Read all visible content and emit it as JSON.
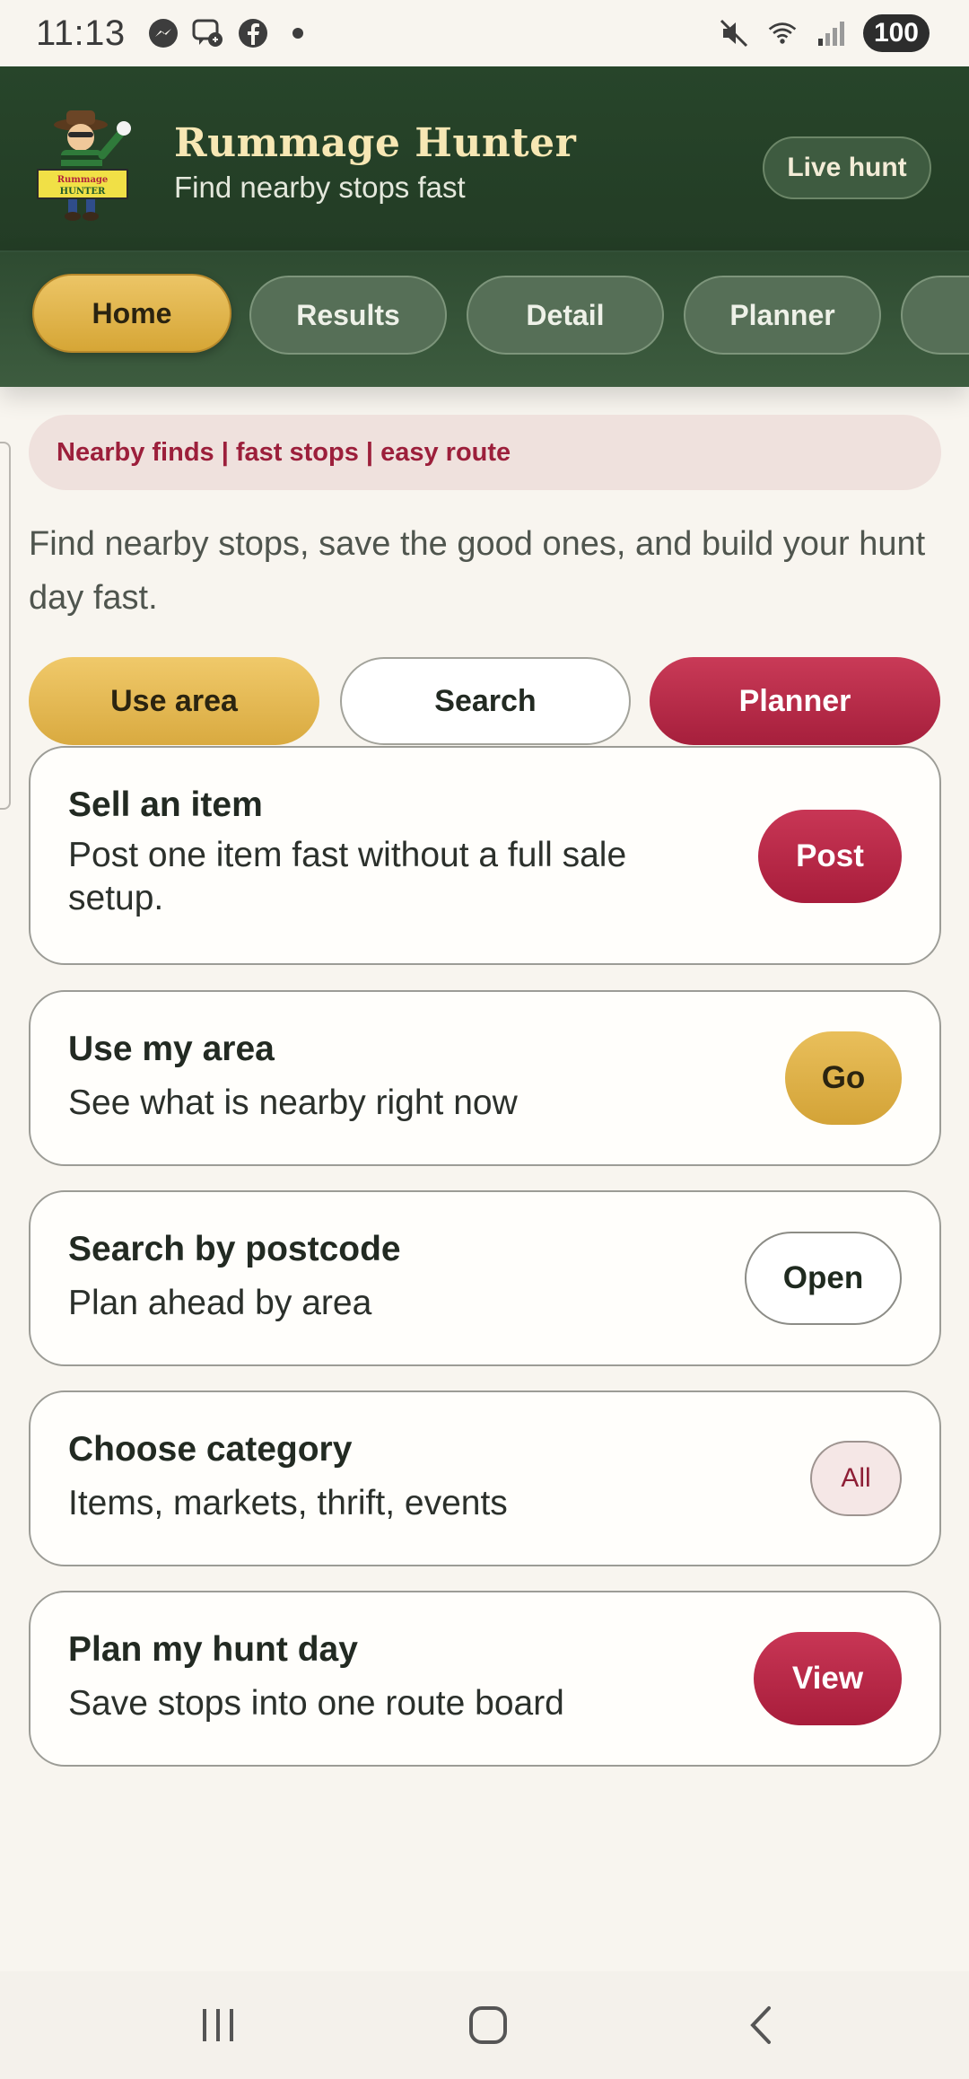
{
  "status_bar": {
    "time": "11:13",
    "battery": "100",
    "notification_icons": [
      "messenger-icon",
      "chat-bubble-icon",
      "facebook-icon",
      "dot-icon"
    ],
    "system_icons": [
      "mute-icon",
      "wifi-icon",
      "signal-icon"
    ]
  },
  "header": {
    "logo_text": "Rummage Hunter",
    "title": "Rummage Hunter",
    "subtitle": "Find nearby stops fast",
    "live_hunt_label": "Live hunt"
  },
  "tabs": [
    {
      "label": "Home",
      "active": true
    },
    {
      "label": "Results",
      "active": false
    },
    {
      "label": "Detail",
      "active": false
    },
    {
      "label": "Planner",
      "active": false
    },
    {
      "label": "",
      "active": false
    }
  ],
  "tagline": "Nearby finds | fast stops | easy route",
  "intro": "Find nearby stops, save the good ones, and build your hunt day fast.",
  "actions": {
    "use_area": "Use area",
    "search": "Search",
    "planner": "Planner"
  },
  "cards": [
    {
      "title": "Sell an item",
      "description": "Post one item fast without a full sale setup.",
      "button": "Post"
    },
    {
      "title": "Use my area",
      "description": "See what is nearby right now",
      "button": "Go"
    },
    {
      "title": "Search by postcode",
      "description": "Plan ahead by area",
      "button": "Open"
    },
    {
      "title": "Choose category",
      "description": "Items, markets, thrift, events",
      "button": "All"
    },
    {
      "title": "Plan my hunt day",
      "description": "Save stops into one route board",
      "button": "View"
    }
  ],
  "colors": {
    "header_green": "#27452a",
    "gold": "#d9aa40",
    "crimson": "#a61f3c",
    "background": "#f8f5ef"
  },
  "nav": [
    "recent-apps-icon",
    "home-icon",
    "back-icon"
  ]
}
